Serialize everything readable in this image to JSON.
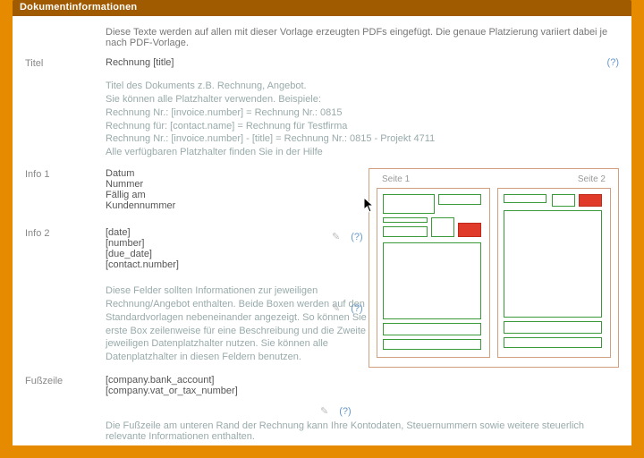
{
  "header": {
    "title": "Dokumentinformationen"
  },
  "intro": "Diese Texte werden auf allen mit dieser Vorlage erzeugten PDFs eingefügt. Die genaue Platzierung variiert dabei je nach PDF-Vorlage.",
  "sections": {
    "title": {
      "label": "Titel",
      "value": "Rechnung [title]",
      "help": "(?)",
      "hints": [
        "Titel des Dokuments z.B. Rechnung, Angebot.",
        "Sie können alle Platzhalter verwenden. Beispiele:",
        "Rechnung Nr.: [invoice.number] = Rechnung Nr.: 0815",
        "Rechnung für: [contact.name] = Rechnung für Testfirma",
        "Rechnung Nr.: [invoice.number] - [title] = Rechnung Nr.: 0815 - Projekt 4711",
        "Alle verfügbaren Platzhalter finden Sie in der Hilfe"
      ]
    },
    "info1": {
      "label": "Info 1",
      "lines": [
        "Datum",
        "Nummer",
        "Fällig am",
        "Kundennummer"
      ],
      "help": "(?)"
    },
    "info2": {
      "label": "Info 2",
      "lines": [
        "[date]",
        "[number]",
        "[due_date]",
        "[contact.number]"
      ],
      "help": "(?)"
    },
    "info_note": "Diese Felder sollten Informationen zur jeweiligen Rechnung/Angebot enthalten. Beide Boxen werden auf den Standardvorlagen nebeneinander angezeigt. So können Sie die erste Box zeilenweise für eine Beschreibung und die Zweite für den jeweiligen Datenplatzhalter nutzen. Sie können alle Datenplatzhalter in diesen Feldern benutzen.",
    "footer": {
      "label": "Fußzeile",
      "lines": [
        "[company.bank_account]",
        "[company.vat_or_tax_number]"
      ],
      "help": "(?)",
      "note": "Die Fußzeile am unteren Rand der Rechnung kann Ihre Kontodaten, Steuernummern sowie weitere steuerlich relevante Informationen enthalten."
    }
  },
  "preview": {
    "page1_label": "Seite 1",
    "page2_label": "Seite 2"
  },
  "pencil_glyph": "✎"
}
